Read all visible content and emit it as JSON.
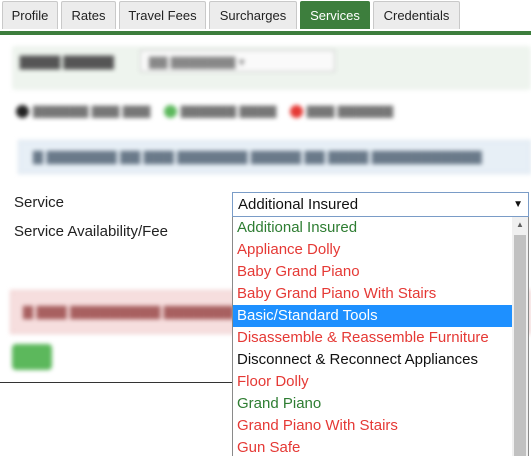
{
  "tabs": {
    "profile": "Profile",
    "rates": "Rates",
    "travel_fees": "Travel Fees",
    "surcharges": "Surcharges",
    "services": "Services",
    "credentials": "Credentials"
  },
  "form": {
    "service_label": "Service",
    "availability_label": "Service Availability/Fee",
    "service_selected": "Additional Insured"
  },
  "dropdown": {
    "options": [
      {
        "label": "Additional Insured",
        "color": "#2e7d32"
      },
      {
        "label": "Appliance Dolly",
        "color": "#e53935"
      },
      {
        "label": "Baby Grand Piano",
        "color": "#e53935"
      },
      {
        "label": "Baby Grand Piano With Stairs",
        "color": "#e53935"
      },
      {
        "label": "Basic/Standard Tools",
        "color": "#111111"
      },
      {
        "label": "Disassemble & Reassemble Furniture",
        "color": "#e53935"
      },
      {
        "label": "Disconnect & Reconnect Appliances",
        "color": "#111111"
      },
      {
        "label": "Floor Dolly",
        "color": "#e53935"
      },
      {
        "label": "Grand Piano",
        "color": "#2e7d32"
      },
      {
        "label": "Grand Piano With Stairs",
        "color": "#e53935"
      },
      {
        "label": "Gun Safe",
        "color": "#e53935"
      }
    ],
    "highlighted_index": 4
  },
  "colors": {
    "tab_active": "#3d7e3d",
    "highlight": "#1e90ff",
    "offered": "#2e7d32",
    "not_offered": "#e53935"
  }
}
